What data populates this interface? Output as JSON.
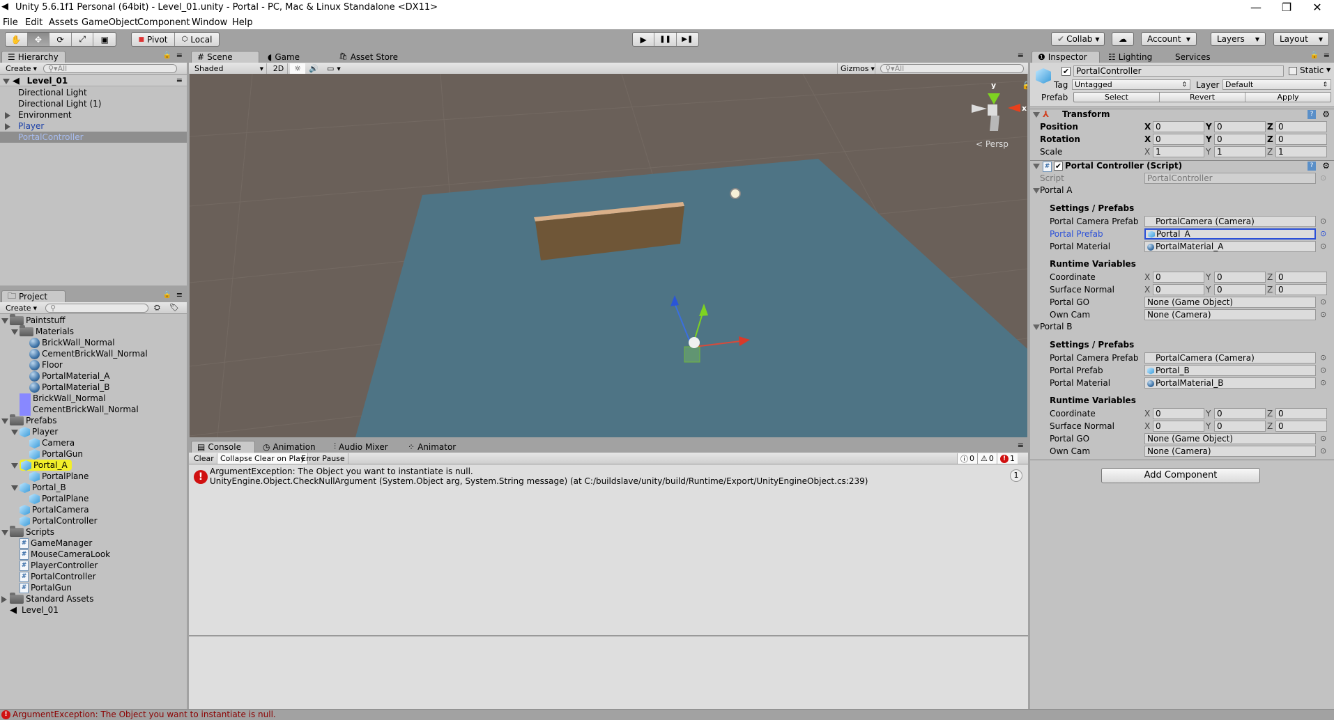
{
  "window": {
    "title": "Unity 5.6.1f1 Personal (64bit) - Level_01.unity - Portal - PC, Mac & Linux Standalone <DX11>",
    "controls": {
      "minimize": "—",
      "maximize": "❐",
      "close": "✕"
    }
  },
  "menu": [
    "File",
    "Edit",
    "Assets",
    "GameObject",
    "Component",
    "Window",
    "Help"
  ],
  "toolbar": {
    "tools": [
      {
        "name": "hand-tool",
        "glyph": "✋"
      },
      {
        "name": "move-tool",
        "glyph": "✥"
      },
      {
        "name": "rotate-tool",
        "glyph": "⟳"
      },
      {
        "name": "scale-tool",
        "glyph": "⤢"
      },
      {
        "name": "rect-tool",
        "glyph": "▣"
      }
    ],
    "active_tool": "move-tool",
    "pivot_label": "Pivot",
    "local_label": "Local",
    "play_glyph": "▶",
    "pause_glyph": "❚❚",
    "step_glyph": "▶❚",
    "collab_label": "Collab",
    "cloud_glyph": "☁",
    "account_label": "Account",
    "layers_label": "Layers",
    "layout_label": "Layout"
  },
  "hierarchy": {
    "tab_label": "Hierarchy",
    "create_label": "Create",
    "search_placeholder": "All",
    "scene_name": "Level_01",
    "items": [
      {
        "label": "Directional Light",
        "expander": "none",
        "color": "#000000",
        "selected": false
      },
      {
        "label": "Directional Light (1)",
        "expander": "none",
        "color": "#000000",
        "selected": false
      },
      {
        "label": "Environment",
        "expander": "collapsed",
        "color": "#000000",
        "selected": false
      },
      {
        "label": "Player",
        "expander": "collapsed",
        "color": "#1a3fa8",
        "selected": false
      },
      {
        "label": "PortalController",
        "expander": "none",
        "color": "#a8bdf0",
        "selected": true
      }
    ]
  },
  "project": {
    "tab_label": "Project",
    "create_label": "Create",
    "search_placeholder": "",
    "items": [
      {
        "label": "Paintstuff",
        "depth": 0,
        "icon": "folder",
        "expander": "expanded"
      },
      {
        "label": "Materials",
        "depth": 1,
        "icon": "folder",
        "expander": "expanded"
      },
      {
        "label": "BrickWall_Normal",
        "depth": 2,
        "icon": "material",
        "expander": "none"
      },
      {
        "label": "CementBrickWall_Normal",
        "depth": 2,
        "icon": "material",
        "expander": "none"
      },
      {
        "label": "Floor",
        "depth": 2,
        "icon": "material",
        "expander": "none"
      },
      {
        "label": "PortalMaterial_A",
        "depth": 2,
        "icon": "material",
        "expander": "none"
      },
      {
        "label": "PortalMaterial_B",
        "depth": 2,
        "icon": "material",
        "expander": "none"
      },
      {
        "label": "BrickWall_Normal",
        "depth": 1,
        "icon": "texture",
        "expander": "none"
      },
      {
        "label": "CementBrickWall_Normal",
        "depth": 1,
        "icon": "texture",
        "expander": "none"
      },
      {
        "label": "Prefabs",
        "depth": 0,
        "icon": "folder",
        "expander": "expanded"
      },
      {
        "label": "Player",
        "depth": 1,
        "icon": "prefab",
        "expander": "expanded"
      },
      {
        "label": "Camera",
        "depth": 2,
        "icon": "prefab",
        "expander": "none"
      },
      {
        "label": "PortalGun",
        "depth": 2,
        "icon": "prefab",
        "expander": "none"
      },
      {
        "label": "Portal_A",
        "depth": 1,
        "icon": "prefab",
        "expander": "expanded",
        "highlight": true
      },
      {
        "label": "PortalPlane",
        "depth": 2,
        "icon": "prefab",
        "expander": "none"
      },
      {
        "label": "Portal_B",
        "depth": 1,
        "icon": "prefab",
        "expander": "expanded"
      },
      {
        "label": "PortalPlane",
        "depth": 2,
        "icon": "prefab",
        "expander": "none"
      },
      {
        "label": "PortalCamera",
        "depth": 1,
        "icon": "prefab",
        "expander": "none"
      },
      {
        "label": "PortalController",
        "depth": 1,
        "icon": "prefab",
        "expander": "none"
      },
      {
        "label": "Scripts",
        "depth": 0,
        "icon": "folder",
        "expander": "expanded"
      },
      {
        "label": "GameManager",
        "depth": 1,
        "icon": "script",
        "expander": "none"
      },
      {
        "label": "MouseCameraLook",
        "depth": 1,
        "icon": "script",
        "expander": "none"
      },
      {
        "label": "PlayerController",
        "depth": 1,
        "icon": "script",
        "expander": "none"
      },
      {
        "label": "PortalController",
        "depth": 1,
        "icon": "script",
        "expander": "none"
      },
      {
        "label": "PortalGun",
        "depth": 1,
        "icon": "script",
        "expander": "none"
      },
      {
        "label": "Standard Assets",
        "depth": 0,
        "icon": "folder",
        "expander": "collapsed"
      },
      {
        "label": "Level_01",
        "depth": 0,
        "icon": "scene",
        "expander": "none"
      }
    ]
  },
  "scene": {
    "tabs": [
      {
        "label": "Scene",
        "glyph": "#",
        "active": true
      },
      {
        "label": "Game",
        "glyph": "◖",
        "active": false
      },
      {
        "label": "Asset Store",
        "glyph": "🛍",
        "active": false
      }
    ],
    "shading_mode": "Shaded",
    "mode_2d": "2D",
    "gizmos_label": "Gizmos",
    "search_placeholder": "All",
    "projection_label": "Persp",
    "axis_labels": {
      "x": "x",
      "y": "y"
    }
  },
  "console": {
    "tabs": [
      {
        "label": "Console",
        "glyph": "▤",
        "active": true
      },
      {
        "label": "Animation",
        "glyph": "◷",
        "active": false
      },
      {
        "label": "Audio Mixer",
        "glyph": "⫶",
        "active": false
      },
      {
        "label": "Animator",
        "glyph": "⁘",
        "active": false
      }
    ],
    "buttons": [
      "Clear",
      "Collapse",
      "Clear on Play",
      "Error Pause"
    ],
    "counts": {
      "info": "0",
      "warning": "0",
      "error": "1"
    },
    "entries": [
      {
        "type": "error",
        "line1": "ArgumentException: The Object you want to instantiate is null.",
        "line2": "UnityEngine.Object.CheckNullArgument (System.Object arg, System.String message) (at C:/buildslave/unity/build/Runtime/Export/UnityEngineObject.cs:239)",
        "count": "1"
      }
    ]
  },
  "inspector": {
    "tabs": [
      {
        "label": "Inspector",
        "glyph": "❶",
        "active": true
      },
      {
        "label": "Lighting",
        "glyph": "☷",
        "active": false
      },
      {
        "label": "Services",
        "glyph": "",
        "active": false
      }
    ],
    "object_name": "PortalController",
    "active": true,
    "static_label": "Static",
    "static": false,
    "tag_label": "Tag",
    "tag_value": "Untagged",
    "layer_label": "Layer",
    "layer_value": "Default",
    "prefab_label": "Prefab",
    "prefab_buttons": [
      "Select",
      "Revert",
      "Apply"
    ],
    "transform": {
      "title": "Transform",
      "rows": [
        {
          "label": "Position",
          "bold": true,
          "x": "0",
          "y": "0",
          "z": "0"
        },
        {
          "label": "Rotation",
          "bold": true,
          "x": "0",
          "y": "0",
          "z": "0"
        },
        {
          "label": "Scale",
          "bold": false,
          "x": "1",
          "y": "1",
          "z": "1"
        }
      ]
    },
    "script_component": {
      "title": "Portal Controller (Script)",
      "script_label": "Script",
      "script_value": "PortalController",
      "portals": [
        {
          "header": "Portal A",
          "settings_header": "Settings / Prefabs",
          "camera_prefab_label": "Portal Camera Prefab",
          "camera_prefab_value": "PortalCamera (Camera)",
          "prefab_label": "Portal Prefab",
          "prefab_value": "Portal_A",
          "material_label": "Portal Material",
          "material_value": "PortalMaterial_A",
          "runtime_header": "Runtime Variables",
          "coordinate_label": "Coordinate",
          "coordinate": {
            "x": "0",
            "y": "0",
            "z": "0"
          },
          "normal_label": "Surface Normal",
          "normal": {
            "x": "0",
            "y": "0",
            "z": "0"
          },
          "go_label": "Portal GO",
          "go_value": "None (Game Object)",
          "cam_label": "Own Cam",
          "cam_value": "None (Camera)"
        },
        {
          "header": "Portal B",
          "settings_header": "Settings / Prefabs",
          "camera_prefab_label": "Portal Camera Prefab",
          "camera_prefab_value": "PortalCamera (Camera)",
          "prefab_label": "Portal Prefab",
          "prefab_value": "Portal_B",
          "material_label": "Portal Material",
          "material_value": "PortalMaterial_B",
          "runtime_header": "Runtime Variables",
          "coordinate_label": "Coordinate",
          "coordinate": {
            "x": "0",
            "y": "0",
            "z": "0"
          },
          "normal_label": "Surface Normal",
          "normal": {
            "x": "0",
            "y": "0",
            "z": "0"
          },
          "go_label": "Portal GO",
          "go_value": "None (Game Object)",
          "cam_label": "Own Cam",
          "cam_value": "None (Camera)"
        }
      ]
    },
    "add_component_label": "Add Component"
  },
  "statusbar": {
    "message": "ArgumentException: The Object you want to instantiate is null.",
    "color": "#8b0000"
  },
  "colors": {
    "selection": "#8e8e8e",
    "highlight": "#f2ee2a",
    "focus_blue": "#2a4fd8",
    "error_red": "#d01010"
  }
}
